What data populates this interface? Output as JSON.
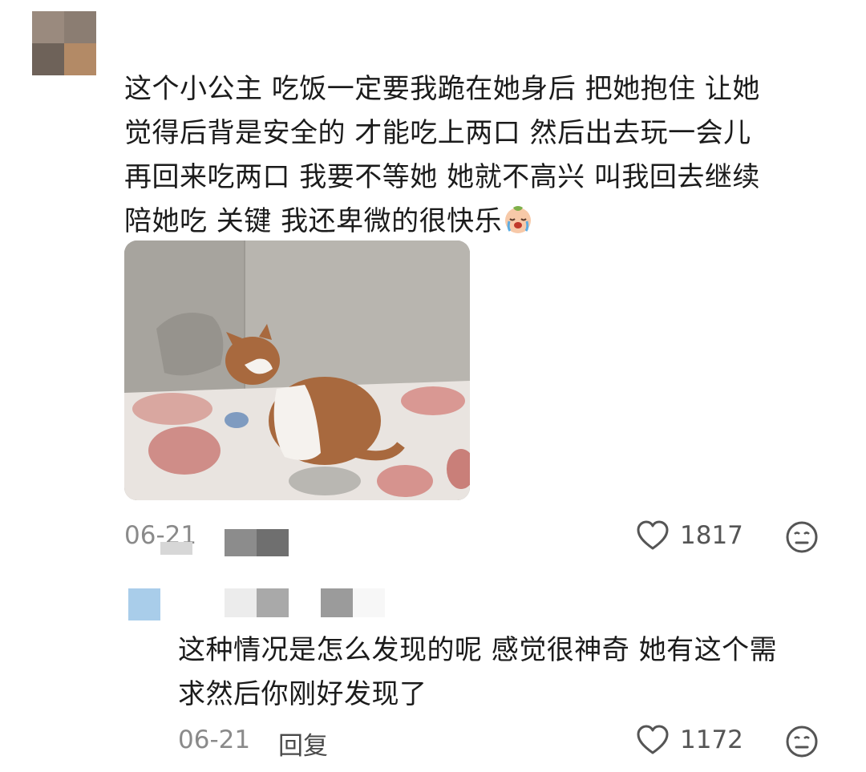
{
  "main_comment": {
    "text_lines": [
      "这个小公主 吃饭一定要我跪在她身后 把她抱住 让她",
      "觉得后背是安全的 才能吃上两口 然后出去玩一会儿",
      "再回来吃两口 我要不等她 她就不高兴 叫我回去继续",
      "陪她吃 关键 我还卑微的很快乐"
    ],
    "emoji": "crying-face-emoji",
    "date": "06-21",
    "like_count": "1817"
  },
  "reply_comment": {
    "text_lines": [
      "这种情况是怎么发现的呢 感觉很神奇 她有这个需",
      "求然后你刚好发现了"
    ],
    "date": "06-21",
    "reply_label": "回复",
    "like_count": "1172"
  },
  "colors": {
    "text": "#1b1b1b",
    "meta": "#8a8a8a",
    "icon": "#555555",
    "reply_avatar": "#a9cdea"
  }
}
